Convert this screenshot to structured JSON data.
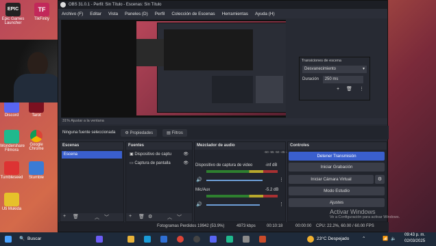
{
  "obs": {
    "window_title": "OBS 31.0.1 - Perfil: Sin Título - Escenas: Sin Título",
    "menu": [
      "Archivo (F)",
      "Editar",
      "Vista",
      "Paneles (D)",
      "Perfil",
      "Colección de Escenas",
      "Herramientas",
      "Ayuda (H)"
    ],
    "zoom_label": "31%  Ajustar a la ventana",
    "no_source": "Ninguna fuente seleccionada",
    "properties_btn": "Propiedades",
    "filters_btn": "Filtros",
    "scenes": {
      "title": "Escenas",
      "items": [
        "Escena"
      ]
    },
    "sources": {
      "title": "Fuentes",
      "items": [
        "Dispositivo de captu",
        "Captura de pantalla"
      ]
    },
    "mixer": {
      "title": "Mezclador de audio",
      "scale": "-60 -55 -50 -45 -40 -35 -30 -25 -20 -15 -10 -5 0",
      "channels": [
        {
          "name": "Dispositivo de captura de video",
          "db": "-inf dB"
        },
        {
          "name": "Mic/Aux",
          "db": "-5.2 dB"
        }
      ]
    },
    "controls": {
      "title": "Controles",
      "buttons": [
        "Detener Transmisión",
        "Iniciar Grabación",
        "Iniciar Cámara Virtual",
        "Modo Estudio",
        "Ajustes"
      ]
    },
    "status": {
      "dropped": "Fotogramas Perdidos 19942 (53.9%)",
      "bitrate": "4973 kbps",
      "time": "00:10:18",
      "time2": "00:00:00",
      "cpu": "CPU: 22.2%, 60.00 / 60.00 FPS"
    },
    "transitions": {
      "title": "Transiciones de escena",
      "type": "Desvanecimiento",
      "duration_label": "Duración",
      "duration_value": "250 ms"
    }
  },
  "desktop": {
    "icons": [
      "Epic Games Launcher",
      "TikFinity",
      "Discord",
      "Tarot",
      "Wondershare Filmora",
      "Google Chrome",
      "Tumbleseed",
      "Stumble",
      "Uti Mukida"
    ]
  },
  "watermark": {
    "line1": "Activar Windows",
    "line2": "Ve a Configuración para activar Windows."
  },
  "taskbar": {
    "search": "Buscar",
    "weather": "23°C  Despejado",
    "time": "09:43 p. m.",
    "date": "02/03/2025"
  }
}
